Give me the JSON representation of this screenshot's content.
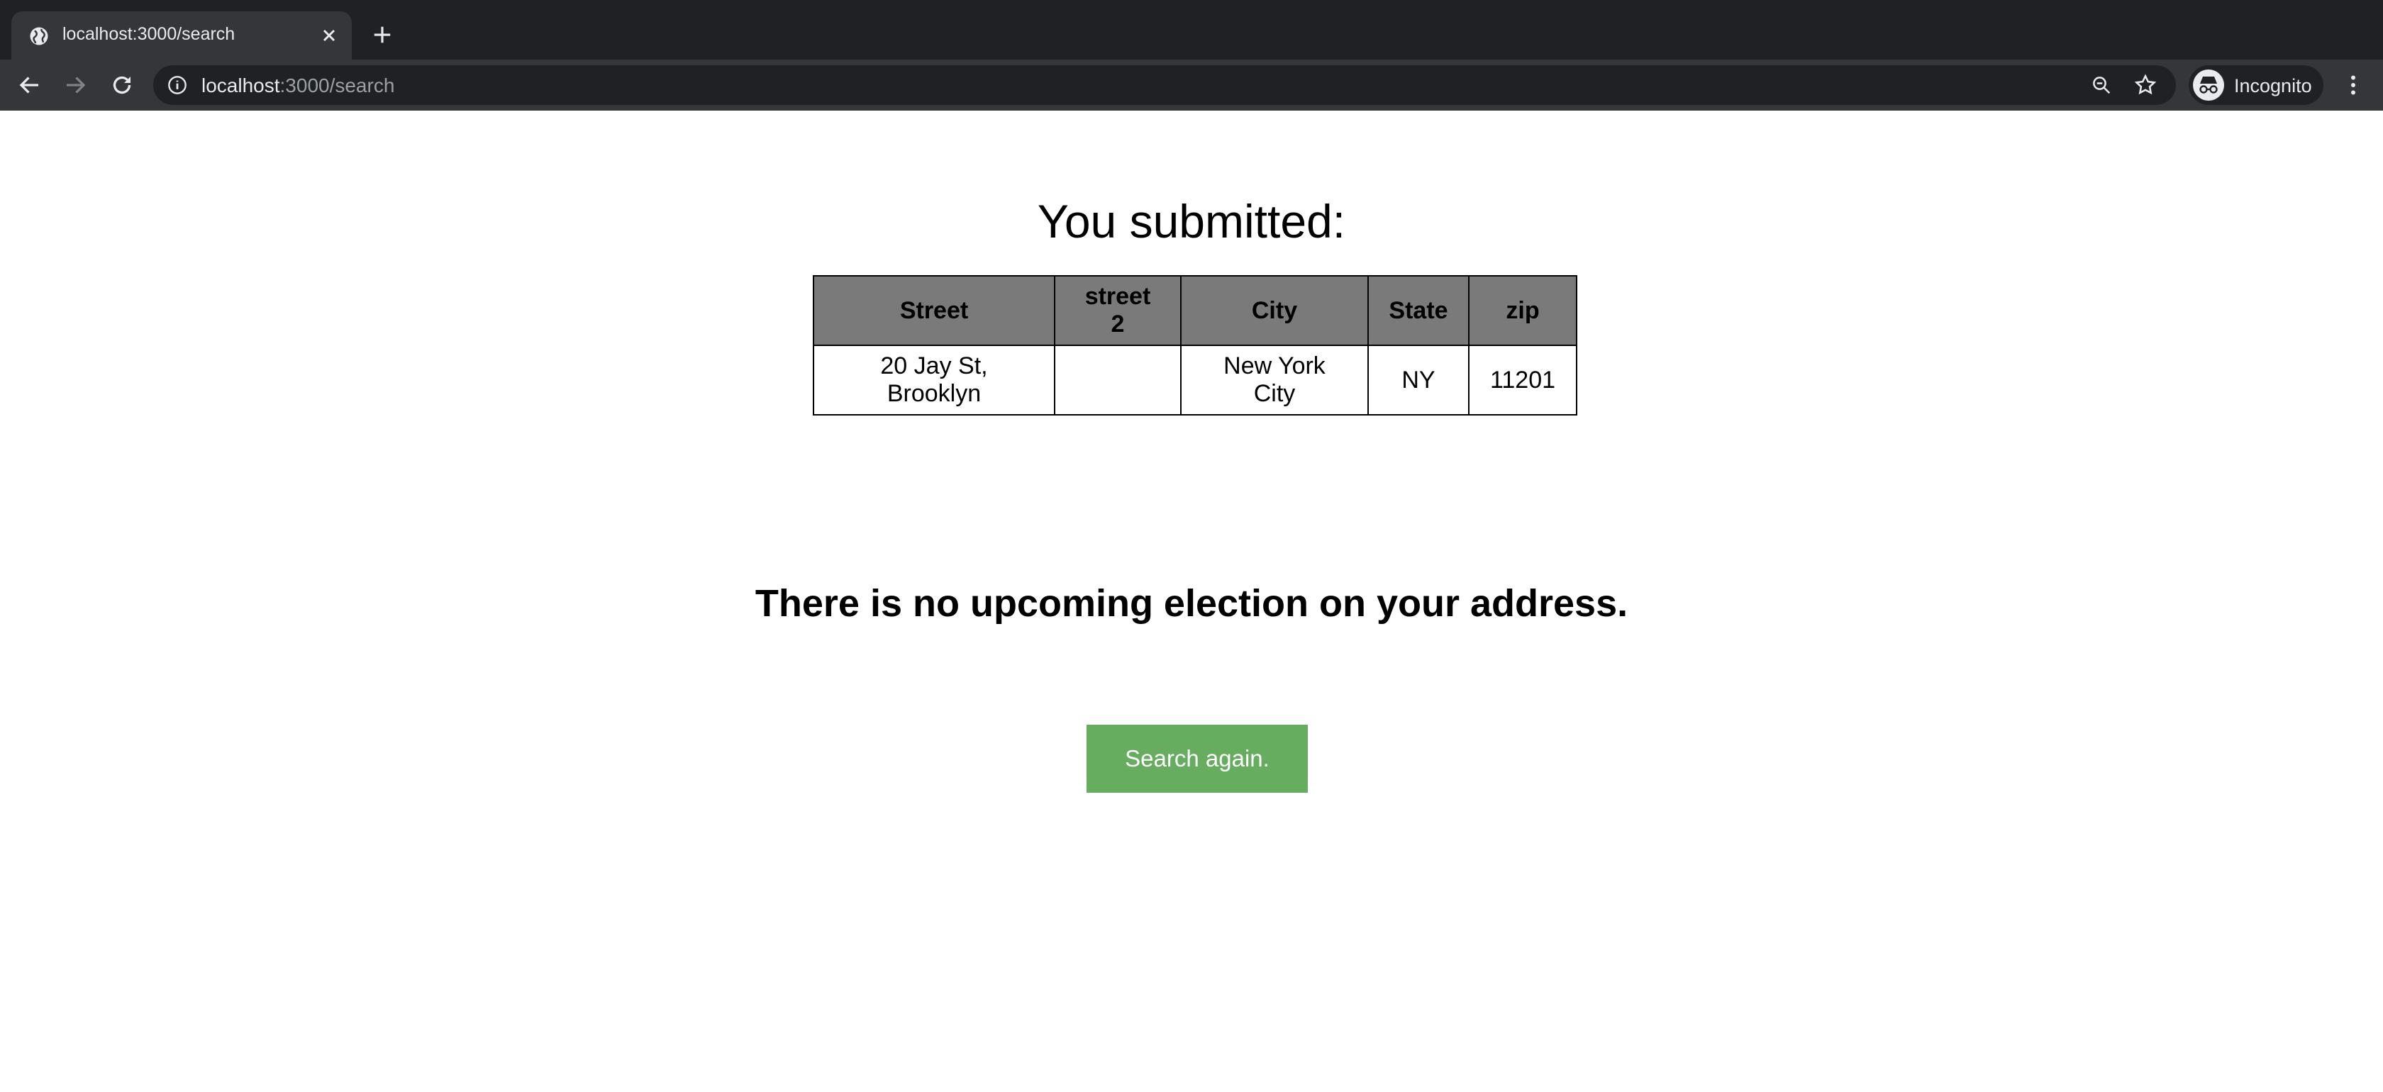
{
  "browser": {
    "tab_title": "localhost:3000/search",
    "url_host": "localhost",
    "url_path": ":3000/search",
    "profile_label": "Incognito"
  },
  "page": {
    "heading": "You submitted:",
    "table": {
      "headers": [
        "Street",
        "street 2",
        "City",
        "State",
        "zip"
      ],
      "row": [
        "20 Jay St, Brooklyn",
        "",
        "New York City",
        "NY",
        "11201"
      ]
    },
    "message": "There is no upcoming election on your address.",
    "button_label": "Search again.",
    "button_color": "#66ad5f",
    "header_bg": "#7a7a7a"
  }
}
